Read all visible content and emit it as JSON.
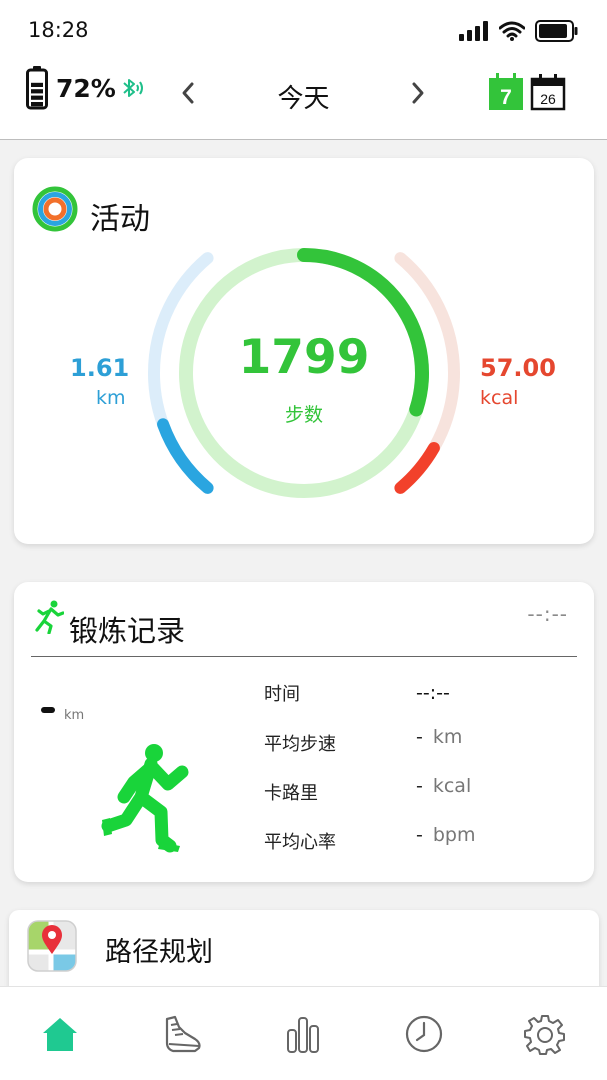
{
  "status_bar": {
    "time": "18:28",
    "icons": [
      "signal-icon",
      "wifi-icon",
      "battery-icon"
    ]
  },
  "header": {
    "battery_percent": "72%",
    "battery_level": 0.72,
    "bluetooth_icon": "bluetooth-icon",
    "prev_icon": "chevron-left-icon",
    "next_icon": "chevron-right-icon",
    "day_title": "今天",
    "week_calendar_number": "7",
    "month_calendar_number": "26",
    "colors": {
      "accent_green": "#33c43a"
    }
  },
  "activity": {
    "title": "活动",
    "steps": {
      "value": "1799",
      "label": "步数",
      "progress": 0.3,
      "color": "#33c43a",
      "track_color": "#d2f3cd"
    },
    "distance": {
      "value": "1.61",
      "unit": "km",
      "progress": 0.3,
      "color": "#2aa5e0",
      "track_color": "#dcedfa"
    },
    "calories": {
      "value": "57.00",
      "unit": "kcal",
      "progress": 0.2,
      "color": "#f2412b",
      "track_color": "#f7e3dd"
    }
  },
  "workout": {
    "title": "锻炼记录",
    "time_display": "--:--",
    "distance_unit": "km",
    "stats": [
      {
        "label": "时间",
        "value": "--:--"
      },
      {
        "label": "平均步速",
        "dash": "-",
        "value": "km"
      },
      {
        "label": "卡路里",
        "dash": "-",
        "value": "kcal"
      },
      {
        "label": "平均心率",
        "dash": "-",
        "value": "bpm"
      }
    ],
    "runner_color": "#19d43a"
  },
  "route": {
    "title": "路径规划",
    "icon": "map-pin-icon"
  },
  "tab_bar": {
    "active_color": "#1fc991",
    "inactive_color": "#666666",
    "tabs": [
      {
        "icon": "home-icon",
        "active": true
      },
      {
        "icon": "sneaker-icon",
        "active": false
      },
      {
        "icon": "bar-chart-icon",
        "active": false
      },
      {
        "icon": "clock-icon",
        "active": false
      },
      {
        "icon": "gear-icon",
        "active": false
      }
    ]
  }
}
